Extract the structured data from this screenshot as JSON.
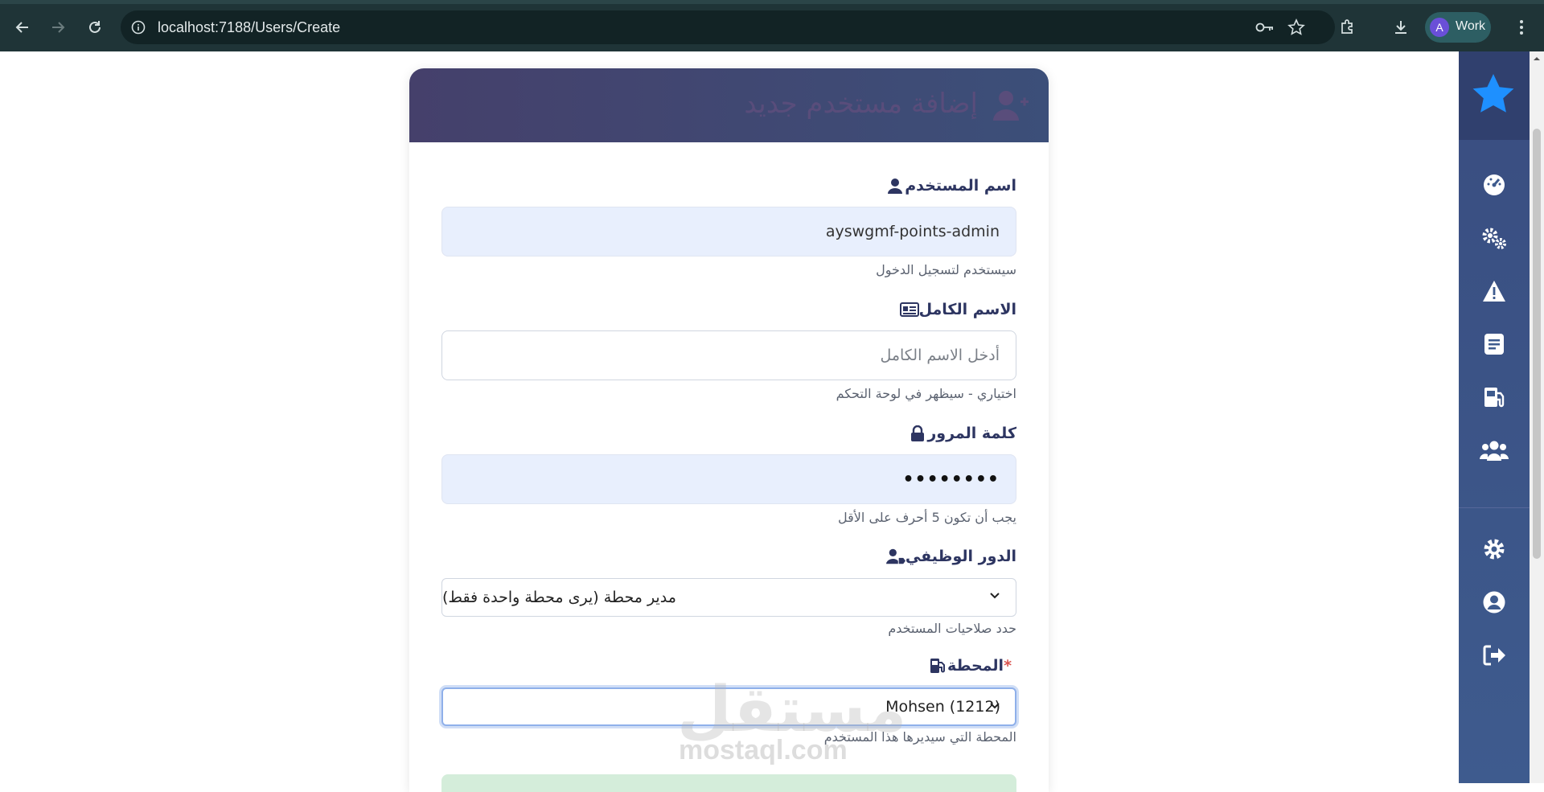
{
  "browser": {
    "url": "localhost:7188/Users/Create",
    "profile_initial": "A",
    "profile_name": "Work"
  },
  "page": {
    "title": "إضافة مستخدم جديد"
  },
  "form": {
    "username": {
      "label": "اسم المستخدم",
      "value": "ayswgmf-points-admin",
      "helper": "سيستخدم لتسجيل الدخول"
    },
    "fullname": {
      "label": "الاسم الكامل",
      "placeholder": "أدخل الاسم الكامل",
      "helper": "اختياري - سيظهر في لوحة التحكم"
    },
    "password": {
      "label": "كلمة المرور",
      "value": "••••••••",
      "helper": "يجب أن تكون 5 أحرف على الأقل"
    },
    "role": {
      "label": "الدور الوظيفي",
      "selected": "مدير محطة (يرى محطة واحدة فقط)",
      "helper": "حدد صلاحيات المستخدم"
    },
    "station": {
      "label": "المحطة",
      "required_mark": "*",
      "selected": "Mohsen (1212)",
      "helper": "المحطة التي سيديرها هذا المستخدم"
    }
  },
  "watermark": {
    "logo_text": "مستقل",
    "url": "mostaql.com"
  },
  "colors": {
    "chrome_bg": "#1f3437",
    "sidebar_bg": "#3e5b8e",
    "header_gradient_start": "#45406b",
    "header_gradient_end": "#3c4f79",
    "label_color": "#2d3561",
    "accent_star": "#1e90ff"
  },
  "icons": {
    "sidebar": [
      "star-icon",
      "dashboard-icon",
      "gears-icon",
      "warning-icon",
      "report-icon",
      "fuel-pump-icon",
      "users-icon",
      "settings-icon",
      "profile-icon",
      "logout-icon"
    ]
  }
}
